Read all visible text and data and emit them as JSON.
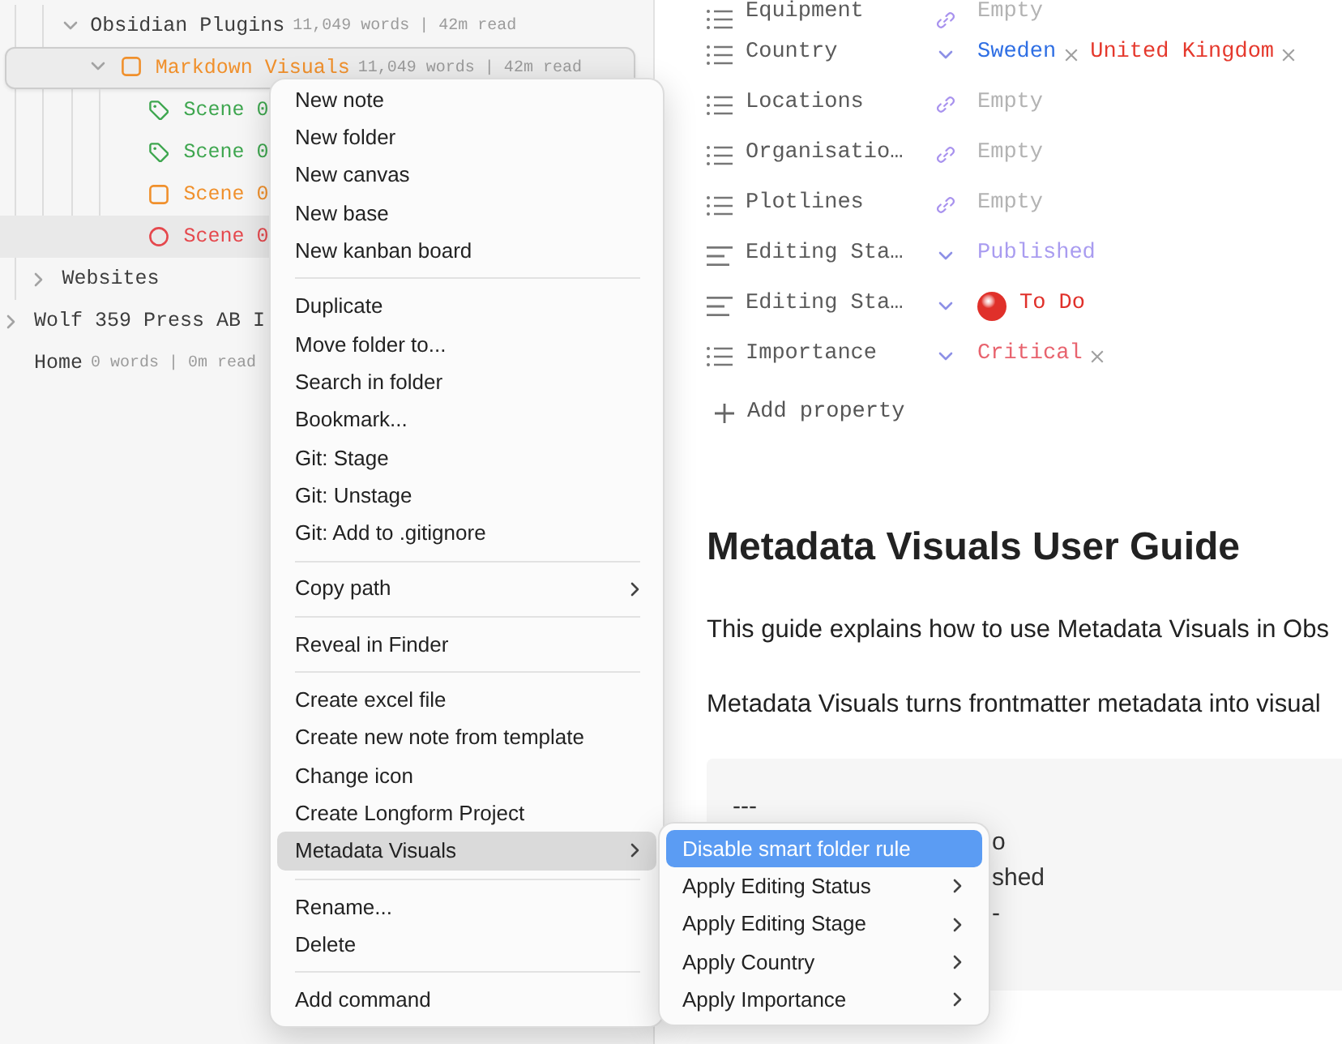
{
  "sidebar": {
    "tree": [
      {
        "children": [
          {
            "children": [
              {
                "label": "Obsidian Plugins",
                "meta": "11,049 words | 42m read",
                "kind": "folder",
                "expanded": true,
                "selected": false,
                "focused": false,
                "children": [
                  {
                    "label": "Markdown Visuals",
                    "meta": "11,049 words | 42m read",
                    "kind": "squarefolder",
                    "color": "#f0902c",
                    "expanded": true,
                    "selected": false,
                    "focused": true,
                    "children": [
                      {
                        "label": "Scene 0",
                        "kind": "tagfile",
                        "color": "#3ea64f",
                        "selected": false,
                        "focused": false
                      },
                      {
                        "label": "Scene 0",
                        "kind": "tagfile",
                        "color": "#3ea64f",
                        "selected": false,
                        "focused": false
                      },
                      {
                        "label": "Scene 0",
                        "kind": "squarefile",
                        "color": "#f0902c",
                        "selected": false,
                        "focused": false
                      },
                      {
                        "label": "Scene 0",
                        "kind": "circlefile",
                        "color": "#e5484d",
                        "selected": true,
                        "focused": false
                      }
                    ]
                  }
                ]
              }
            ]
          },
          {
            "label": "Websites",
            "kind": "folder",
            "expanded": false,
            "selected": false,
            "focused": false
          }
        ]
      },
      {
        "label": "Wolf 359 Press AB I",
        "kind": "folder",
        "expanded": false,
        "selected": false,
        "focused": false
      },
      {
        "label": "Home",
        "meta": "0 words | 0m read",
        "kind": "file",
        "selected": false,
        "focused": false
      }
    ]
  },
  "properties": [
    {
      "name": "Equipment",
      "kind": "linklist",
      "placeholder": "Empty"
    },
    {
      "name": "Country",
      "kind": "selectlist",
      "values": [
        {
          "text": "Sweden",
          "color": "#2f6fe4",
          "removable": true,
          "dot": false
        },
        {
          "text": "United Kingdom",
          "color": "#e5392d",
          "removable": true,
          "dot": false
        }
      ]
    },
    {
      "name": "Locations",
      "kind": "linklist",
      "placeholder": "Empty"
    },
    {
      "name": "Organisatio…",
      "kind": "linklist",
      "placeholder": "Empty"
    },
    {
      "name": "Plotlines",
      "kind": "linklist",
      "placeholder": "Empty"
    },
    {
      "name": "Editing Sta…",
      "kind": "selecttext",
      "values": [
        {
          "text": "Published",
          "color": "#a99cf0",
          "removable": false,
          "dot": false
        }
      ]
    },
    {
      "name": "Editing Sta…",
      "kind": "selecttext",
      "values": [
        {
          "text": "To Do",
          "color": "#e0302a",
          "removable": false,
          "dot": true
        }
      ]
    },
    {
      "name": "Importance",
      "kind": "selectlist",
      "values": [
        {
          "text": "Critical",
          "color": "#e8636e",
          "removable": true,
          "dot": false
        }
      ]
    }
  ],
  "add_property": {
    "label": "Add property"
  },
  "document": {
    "title": "Metadata Visuals User Guide",
    "paragraphs": [
      "This guide explains how to use Metadata Visuals in Obs",
      "Metadata Visuals turns frontmatter metadata into visual"
    ],
    "code_lines": [
      {
        "text": "---",
        "covered": false
      },
      {
        "text": "o",
        "covered": true
      },
      {
        "text": "shed",
        "covered": true
      },
      {
        "text": "-",
        "covered": true
      }
    ]
  },
  "context_menu": {
    "groups": [
      [
        {
          "label": "New note",
          "submenu": false,
          "selected": false
        },
        {
          "label": "New folder",
          "submenu": false,
          "selected": false
        },
        {
          "label": "New canvas",
          "submenu": false,
          "selected": false
        },
        {
          "label": "New base",
          "submenu": false,
          "selected": false
        },
        {
          "label": "New kanban board",
          "submenu": false,
          "selected": false
        }
      ],
      [
        {
          "label": "Duplicate",
          "submenu": false,
          "selected": false
        },
        {
          "label": "Move folder to...",
          "submenu": false,
          "selected": false
        },
        {
          "label": "Search in folder",
          "submenu": false,
          "selected": false
        },
        {
          "label": "Bookmark...",
          "submenu": false,
          "selected": false
        },
        {
          "label": "Git: Stage",
          "submenu": false,
          "selected": false
        },
        {
          "label": "Git: Unstage",
          "submenu": false,
          "selected": false
        },
        {
          "label": "Git: Add to .gitignore",
          "submenu": false,
          "selected": false
        }
      ],
      [
        {
          "label": "Copy path",
          "submenu": true,
          "selected": false
        }
      ],
      [
        {
          "label": "Reveal in Finder",
          "submenu": false,
          "selected": false
        }
      ],
      [
        {
          "label": "Create excel file",
          "submenu": false,
          "selected": false
        },
        {
          "label": "Create new note from template",
          "submenu": false,
          "selected": false
        },
        {
          "label": "Change icon",
          "submenu": false,
          "selected": false
        },
        {
          "label": "Create Longform Project",
          "submenu": false,
          "selected": false
        },
        {
          "label": "Metadata Visuals",
          "submenu": true,
          "selected": true
        }
      ],
      [
        {
          "label": "Rename...",
          "submenu": false,
          "selected": false
        },
        {
          "label": "Delete",
          "submenu": false,
          "selected": false
        }
      ],
      [
        {
          "label": "Add command",
          "submenu": false,
          "selected": false
        }
      ]
    ]
  },
  "submenu": {
    "items": [
      {
        "label": "Disable smart folder rule",
        "submenu": false,
        "selected": true
      },
      {
        "label": "Apply Editing Status",
        "submenu": true,
        "selected": false
      },
      {
        "label": "Apply Editing Stage",
        "submenu": true,
        "selected": false
      },
      {
        "label": "Apply Country",
        "submenu": true,
        "selected": false
      },
      {
        "label": "Apply Importance",
        "submenu": true,
        "selected": false
      }
    ]
  }
}
